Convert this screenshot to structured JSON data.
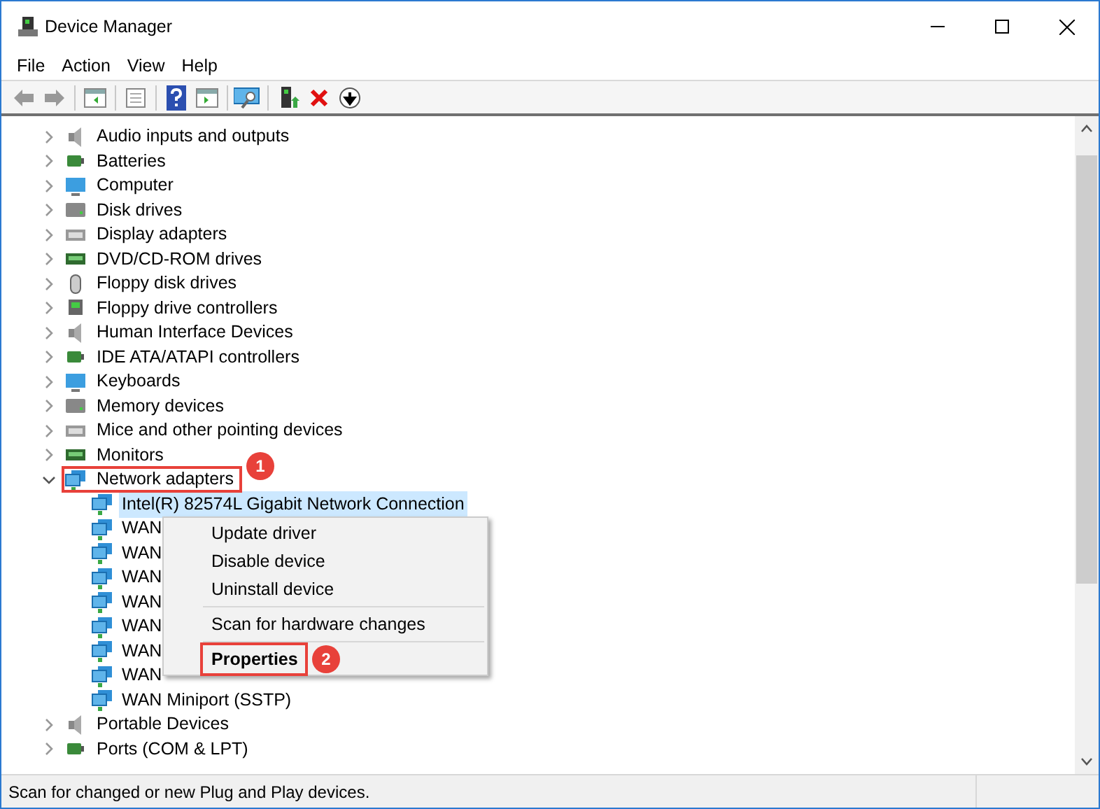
{
  "window": {
    "title": "Device Manager"
  },
  "menu_bar": [
    "File",
    "Action",
    "View",
    "Help"
  ],
  "tree": [
    {
      "label": "Audio inputs and outputs",
      "expanded": false
    },
    {
      "label": "Batteries",
      "expanded": false
    },
    {
      "label": "Computer",
      "expanded": false
    },
    {
      "label": "Disk drives",
      "expanded": false
    },
    {
      "label": "Display adapters",
      "expanded": false
    },
    {
      "label": "DVD/CD-ROM drives",
      "expanded": false
    },
    {
      "label": "Floppy disk drives",
      "expanded": false
    },
    {
      "label": "Floppy drive controllers",
      "expanded": false
    },
    {
      "label": "Human Interface Devices",
      "expanded": false
    },
    {
      "label": "IDE ATA/ATAPI controllers",
      "expanded": false
    },
    {
      "label": "Keyboards",
      "expanded": false
    },
    {
      "label": "Memory devices",
      "expanded": false
    },
    {
      "label": "Mice and other pointing devices",
      "expanded": false
    },
    {
      "label": "Monitors",
      "expanded": false
    },
    {
      "label": "Network adapters",
      "expanded": true,
      "children": [
        {
          "label": "Intel(R) 82574L Gigabit Network Connection",
          "selected": true
        },
        {
          "label": "WAN",
          "selected": false
        },
        {
          "label": "WAN",
          "selected": false
        },
        {
          "label": "WAN",
          "selected": false
        },
        {
          "label": "WAN",
          "selected": false
        },
        {
          "label": "WAN",
          "selected": false
        },
        {
          "label": "WAN",
          "selected": false
        },
        {
          "label": "WAN",
          "selected": false
        },
        {
          "label": "WAN Miniport (SSTP)",
          "selected": false
        }
      ]
    },
    {
      "label": "Portable Devices",
      "expanded": false
    },
    {
      "label": "Ports (COM & LPT)",
      "expanded": false
    }
  ],
  "context_menu": [
    {
      "kind": "item",
      "label": "Update driver",
      "bold": false
    },
    {
      "kind": "item",
      "label": "Disable device",
      "bold": false
    },
    {
      "kind": "item",
      "label": "Uninstall device",
      "bold": false
    },
    {
      "kind": "separator"
    },
    {
      "kind": "item",
      "label": "Scan for hardware changes",
      "bold": false
    },
    {
      "kind": "separator"
    },
    {
      "kind": "item",
      "label": "Properties",
      "bold": true
    }
  ],
  "annotations": [
    "1",
    "2"
  ],
  "status_bar": "Scan for changed or new Plug and Play devices."
}
